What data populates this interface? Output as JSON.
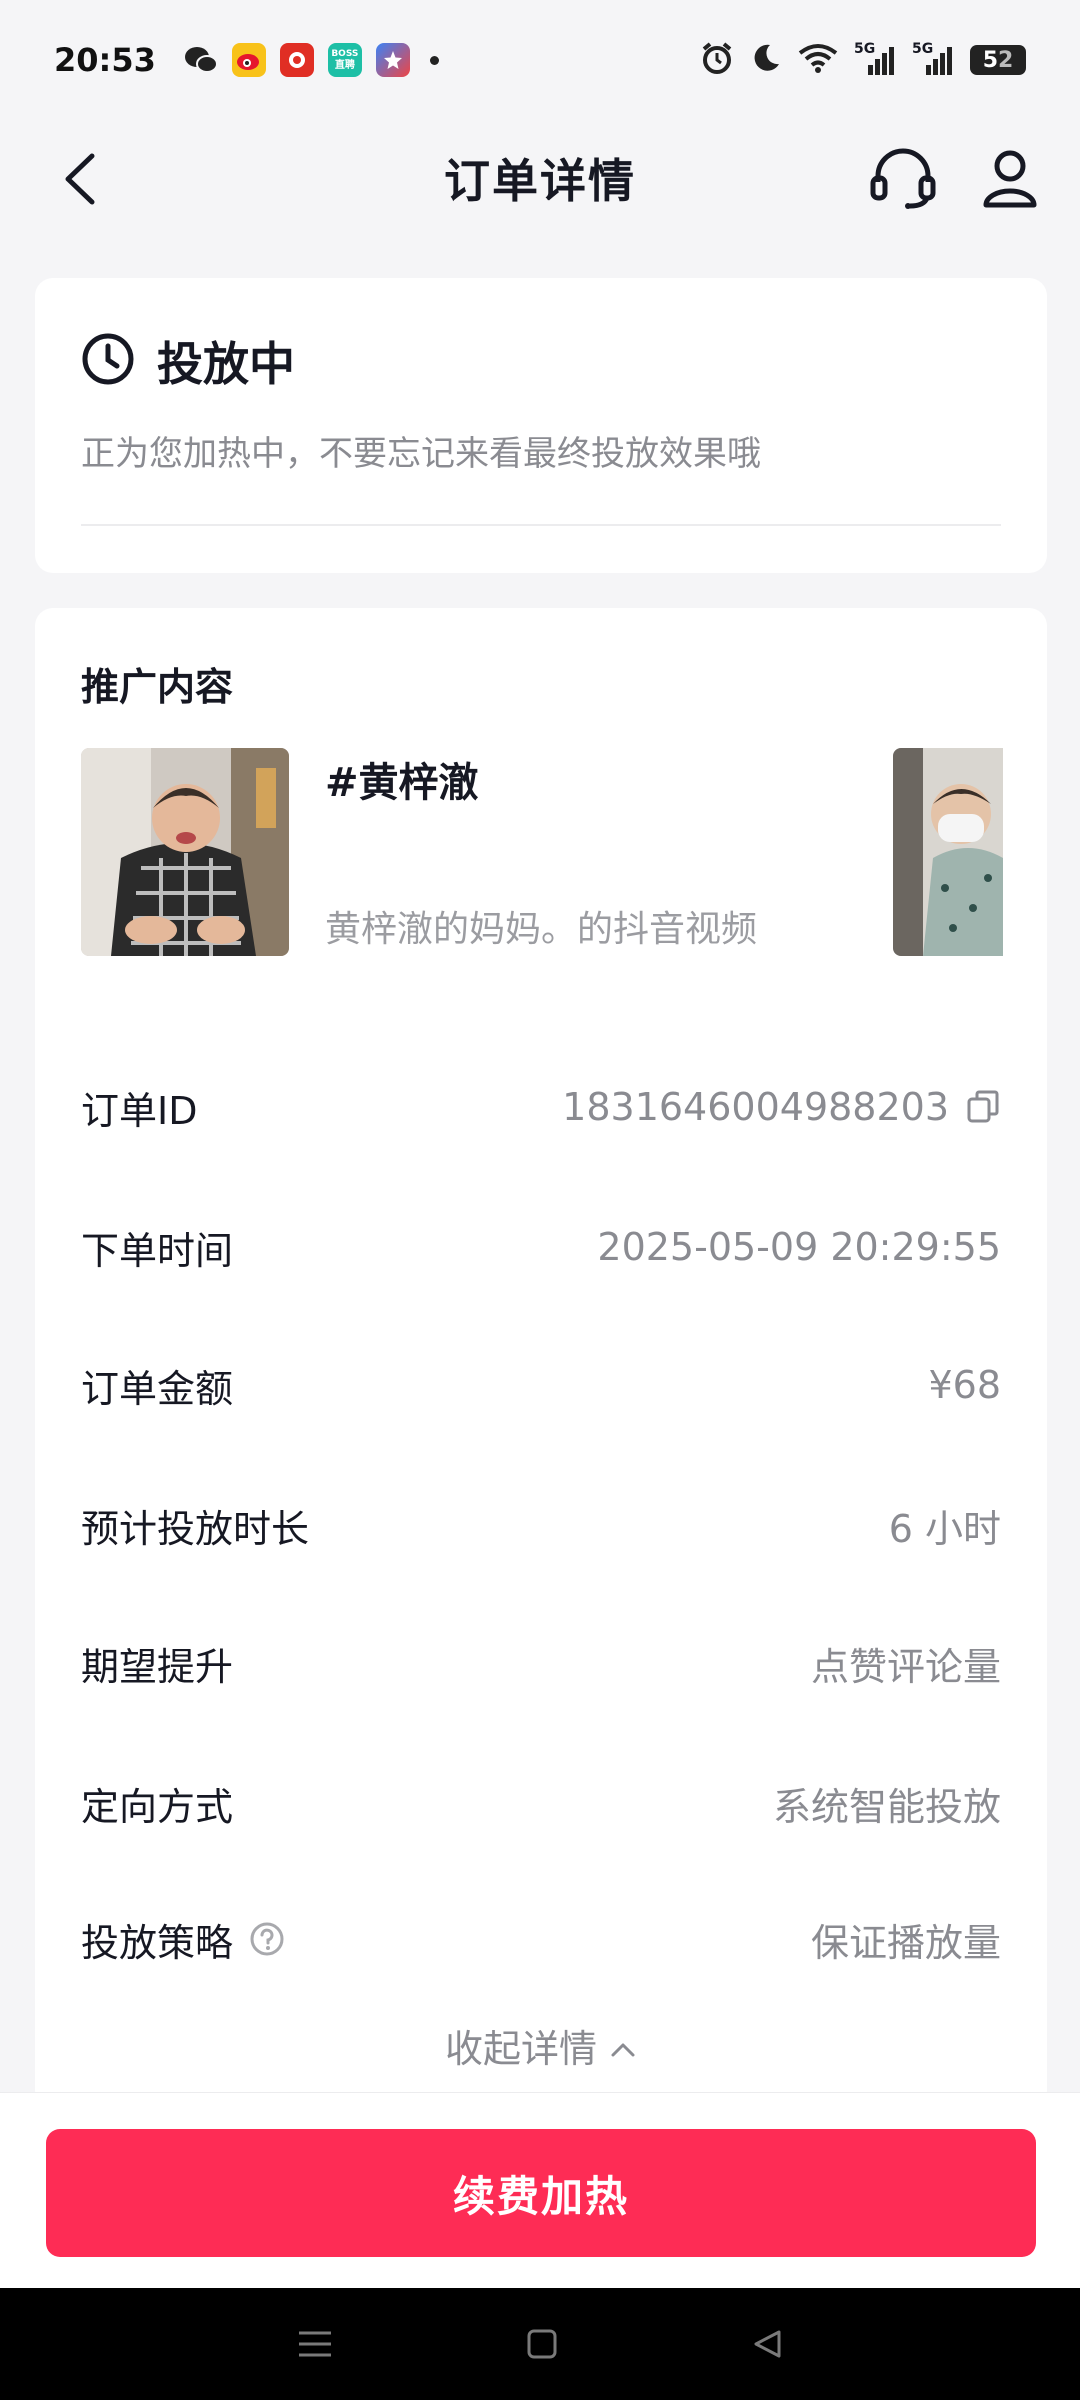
{
  "status_bar": {
    "time": "20:53",
    "apps": [
      "wechat-icon",
      "weibo-icon",
      "pinduoduo-icon",
      "boss-zhipin-icon",
      "app-star-icon"
    ],
    "boss_label": "BOSS",
    "boss_sub": "直聘",
    "signal_labels": [
      "5G",
      "5G"
    ],
    "battery_level": "5",
    "battery_rest": "2"
  },
  "nav": {
    "title": "订单详情"
  },
  "status_card": {
    "title": "投放中",
    "description": "正为您加热中，不要忘记来看最终投放效果哦"
  },
  "detail": {
    "section_title": "推广内容",
    "promo": {
      "title": "#黄梓澈",
      "subtitle": "黄梓澈的妈妈。的抖音视频"
    },
    "rows": [
      {
        "label": "订单ID",
        "value": "1831646004988203"
      },
      {
        "label": "下单时间",
        "value": "2025-05-09 20:29:55"
      },
      {
        "label": "订单金额",
        "value": "¥68"
      },
      {
        "label": "预计投放时长",
        "value": "6 小时"
      },
      {
        "label": "期望提升",
        "value": "点赞评论量"
      },
      {
        "label": "定向方式",
        "value": "系统智能投放"
      },
      {
        "label": "投放策略",
        "value": "保证播放量"
      }
    ],
    "collapse_label": "收起详情"
  },
  "bottom": {
    "renew_label": "续费加热"
  },
  "colors": {
    "accent": "#fe2c55",
    "text_primary": "#161823",
    "text_secondary": "#8a8b91",
    "background": "#f5f5f7"
  }
}
